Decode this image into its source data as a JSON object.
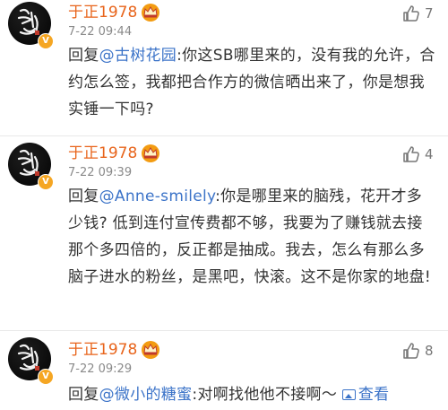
{
  "comments": [
    {
      "username": "于正1978",
      "time": "7-22 09:44",
      "likes": "7",
      "reply_prefix": "回复",
      "mention": "@古树花园",
      "text": ":你这SB哪里来的，没有我的允许，合约怎么签，我都把合作方的微信晒出来了，你是想我实锤一下吗?"
    },
    {
      "username": "于正1978",
      "time": "7-22 09:39",
      "likes": "4",
      "reply_prefix": "回复",
      "mention": "@Anne-smilely",
      "text": ":你是哪里来的脑残，花开才多少钱? 低到连付宣传费都不够，我要为了赚钱就去接那个多四倍的，反正都是抽成。我去，怎么有那么多脑子进水的粉丝，是黑吧，快滚。这不是你家的地盘!"
    },
    {
      "username": "于正1978",
      "time": "7-22 09:29",
      "likes": "8",
      "reply_prefix": "回复",
      "mention": "@微小的糖蜜",
      "text": ":对啊找他他不接啊～",
      "view_image": "查看"
    }
  ],
  "colors": {
    "username": "#e8641b",
    "mention": "#3b73c8",
    "time": "#8a8a8a",
    "badge": "#f5a623"
  },
  "icons": {
    "verified": "verified-v-badge-icon",
    "crown": "crown-member-icon",
    "like": "thumbs-up-icon",
    "image": "image-icon"
  }
}
